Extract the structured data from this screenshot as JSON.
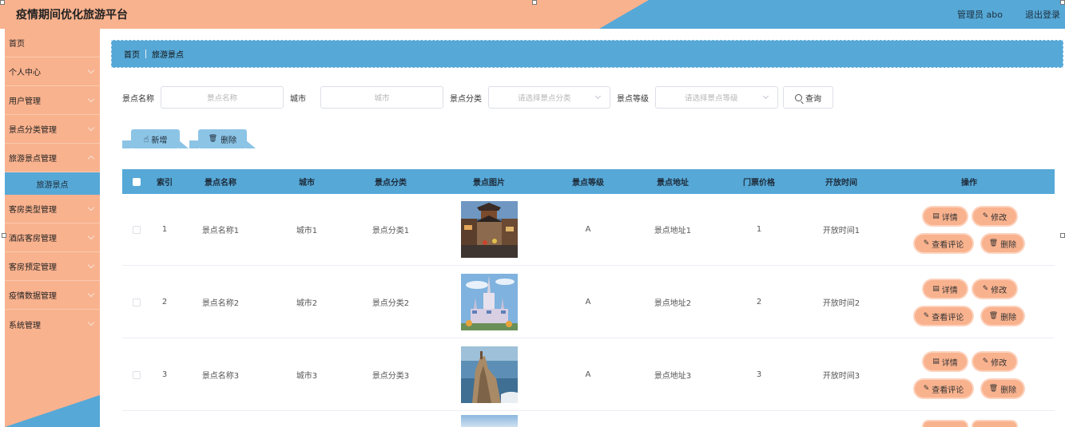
{
  "header": {
    "title": "疫情期间优化旅游平台",
    "admin": "管理员 abo",
    "logout": "退出登录"
  },
  "sidebar": {
    "items": [
      {
        "label": "首页",
        "chevron": false
      },
      {
        "label": "个人中心",
        "chevron": true
      },
      {
        "label": "用户管理",
        "chevron": true
      },
      {
        "label": "景点分类管理",
        "chevron": true
      },
      {
        "label": "旅游景点管理",
        "chevron": true
      },
      {
        "label": "客房类型管理",
        "chevron": true
      },
      {
        "label": "酒店客房管理",
        "chevron": true
      },
      {
        "label": "客房预定管理",
        "chevron": true
      },
      {
        "label": "疫情数据管理",
        "chevron": true
      },
      {
        "label": "系统管理",
        "chevron": true
      }
    ],
    "submenu": {
      "label": "旅游景点"
    }
  },
  "breadcrumb": {
    "home": "首页",
    "current": "旅游景点"
  },
  "search": {
    "name_label": "景点名称",
    "name_placeholder": "景点名称",
    "city_label": "城市",
    "city_placeholder": "城市",
    "category_label": "景点分类",
    "category_placeholder": "请选择景点分类",
    "level_label": "景点等级",
    "level_placeholder": "请选择景点等级",
    "query_label": "查询"
  },
  "actions": {
    "add_label": "新增",
    "delete_label": "删除"
  },
  "table": {
    "headers": [
      "索引",
      "景点名称",
      "城市",
      "景点分类",
      "景点图片",
      "景点等级",
      "景点地址",
      "门票价格",
      "开放时间",
      "操作"
    ],
    "rows": [
      {
        "index": "1",
        "name": "景点名称1",
        "city": "城市1",
        "category": "景点分类1",
        "level": "A",
        "address": "景点地址1",
        "price": "1",
        "open_time": "开放时间1",
        "image": "street"
      },
      {
        "index": "2",
        "name": "景点名称2",
        "city": "城市2",
        "category": "景点分类2",
        "level": "A",
        "address": "景点地址2",
        "price": "2",
        "open_time": "开放时间2",
        "image": "castle"
      },
      {
        "index": "3",
        "name": "景点名称3",
        "city": "城市3",
        "category": "景点分类3",
        "level": "A",
        "address": "景点地址3",
        "price": "3",
        "open_time": "开放时间3",
        "image": "cliff"
      }
    ],
    "ops": {
      "detail": "详情",
      "edit": "修改",
      "comments": "查看评论",
      "delete": "删除"
    }
  },
  "colors": {
    "peach": "#f9b28e",
    "blue": "#56a8d7",
    "light_blue": "#8cc4e6"
  }
}
